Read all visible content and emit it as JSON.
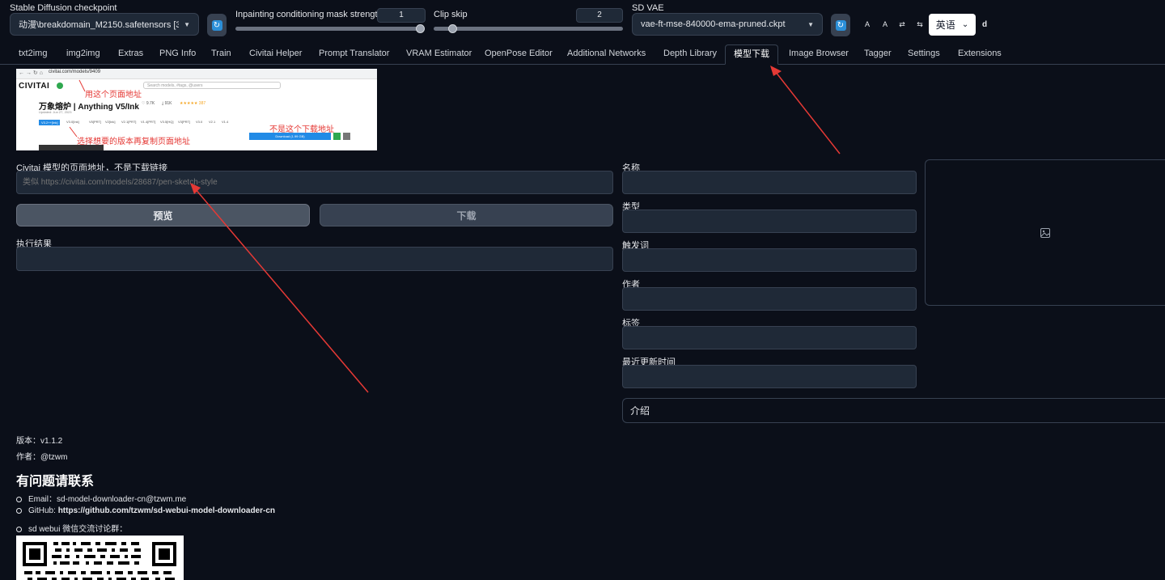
{
  "toolbar": {
    "checkpoint": {
      "label": "Stable Diffusion checkpoint",
      "value": "动漫\\breakdomain_M2150.safetensors [364a130"
    },
    "inpaint": {
      "label": "Inpainting conditioning mask strength",
      "value": "1",
      "level": 1.0
    },
    "clip_skip": {
      "label": "Clip skip",
      "value": "2",
      "level": 0.08
    },
    "vae": {
      "label": "SD VAE",
      "value": "vae-ft-mse-840000-ema-pruned.ckpt"
    },
    "text_tools": [
      "A",
      "A",
      "⇄",
      "⇆"
    ],
    "language": "英语",
    "trailing": "d"
  },
  "tabs": [
    "txt2img",
    "img2img",
    "Extras",
    "PNG Info",
    "Train",
    "Civitai Helper",
    "Prompt Translator",
    "VRAM Estimator",
    "OpenPose Editor",
    "Additional Networks",
    "Depth Library",
    "模型下载",
    "Image Browser",
    "Tagger",
    "Settings",
    "Extensions"
  ],
  "active_tab": "模型下载",
  "guide_image": {
    "url_text": "civitai.com/models/9409",
    "logo": "CIVITAI",
    "search_placeholder": "Search models, #tags, @users",
    "title": "万象熔炉 | Anything V5/Ink",
    "stats": [
      "♡ 9.7K",
      "⤓ 91K",
      "★★★★★ 387"
    ],
    "updated": "Updated: Jun 27, 2023",
    "version_tags": [
      "V3.2++[Ink]",
      "V3.0[Ink]",
      "V5[PRT]",
      "V2[Ink]",
      "V2.1[PRT]",
      "V1.4[PRT]",
      "V3.5[HQ]",
      "V3[PRT]",
      "V3.0",
      "V2.1",
      "V1.4"
    ],
    "download_button": "Download (1.99 GB)",
    "annotation_url": "用这个页面地址",
    "annotation_not_download": "不是这个下载地址",
    "annotation_choose": "选择想要的版本再复制页面地址"
  },
  "form": {
    "url_label": "Civitai 模型的页面地址，不是下载链接",
    "url_placeholder": "类似 https://civitai.com/models/28687/pen-sketch-style",
    "preview_button": "预览",
    "download_button": "下载",
    "result_label": "执行结果",
    "result_value": ""
  },
  "info": {
    "fields": [
      {
        "label": "名称",
        "value": ""
      },
      {
        "label": "类型",
        "value": ""
      },
      {
        "label": "触发词",
        "value": ""
      },
      {
        "label": "作者",
        "value": ""
      },
      {
        "label": "标签",
        "value": ""
      },
      {
        "label": "最近更新时间",
        "value": ""
      }
    ],
    "intro_label": "介绍"
  },
  "footer": {
    "version_label": "版本：",
    "version": "v1.1.2",
    "author_label": "作者：",
    "author": "@tzwm",
    "heading": "有问题请联系",
    "email_label": "Email：",
    "email": "sd-model-downloader-cn@tzwm.me",
    "github_label": "GitHub: ",
    "github": "https://github.com/tzwm/sd-webui-model-downloader-cn",
    "wechat": "sd webui 微信交流讨论群："
  },
  "colors": {
    "background": "#0b0f19",
    "panel": "#1f2937",
    "border": "#374151",
    "accent_blue": "#2b8fd8",
    "annotation_red": "#e53935"
  }
}
